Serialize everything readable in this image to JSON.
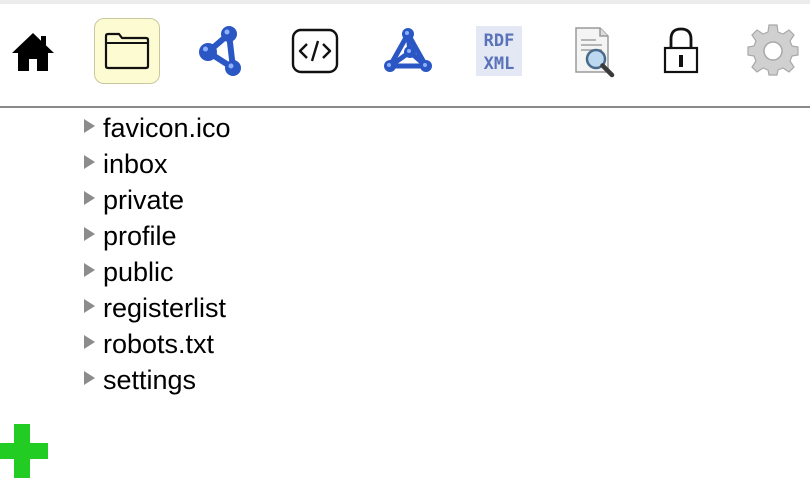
{
  "toolbar": {
    "icons": [
      "home-icon",
      "folder-icon",
      "share-graph-icon",
      "source-code-icon",
      "graph-network-icon",
      "rdf-xml-icon",
      "document-search-icon",
      "lock-icon",
      "gear-icon"
    ],
    "rdf_xml": {
      "line1": "RDF",
      "line2": "XML"
    },
    "selected": "folder-icon"
  },
  "files": {
    "items": [
      {
        "label": "favicon.ico"
      },
      {
        "label": "inbox"
      },
      {
        "label": "private"
      },
      {
        "label": "profile"
      },
      {
        "label": "public"
      },
      {
        "label": "registerlist"
      },
      {
        "label": "robots.txt"
      },
      {
        "label": "settings"
      }
    ]
  },
  "add_button": {
    "icon": "plus-icon",
    "color": "#22cc22"
  },
  "colors": {
    "accent_blue": "#2a57c4",
    "selected_bg": "#fdfbd2",
    "triangle": "#8c8c8c",
    "divider": "#8a8a8a"
  }
}
